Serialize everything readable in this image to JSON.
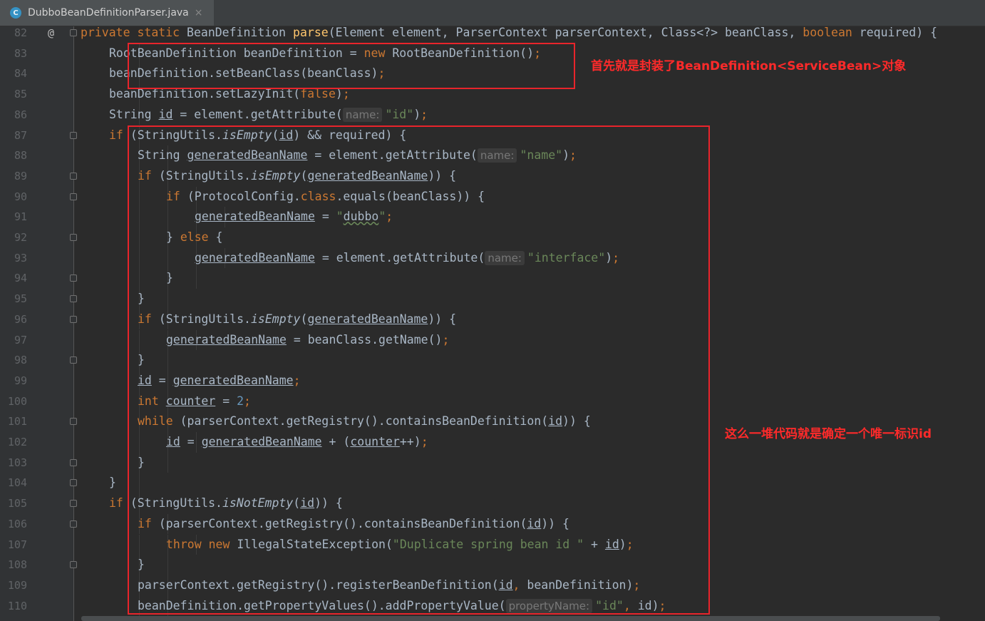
{
  "tab": {
    "icon": "C",
    "title": "DubboBeanDefinitionParser.java",
    "close": "×"
  },
  "gutter_marker": "@",
  "annotations": {
    "note1": "首先就是封装了BeanDefinition<ServiceBean>对象",
    "note2": "这么一堆代码就是确定一个唯一标识id"
  },
  "colors": {
    "keyword": "#cc7832",
    "method_decl": "#ffc66d",
    "string": "#6a8759",
    "number": "#6897bb",
    "default": "#a9b7c6",
    "annotation_red": "#e8242b"
  },
  "lines": [
    {
      "n": "82",
      "i": 1,
      "mark": "@",
      "fold": true,
      "t": [
        [
          "kw",
          "private static "
        ],
        [
          "",
          "BeanDefinition "
        ],
        [
          "fn",
          "parse"
        ],
        [
          "",
          "(Element element, ParserContext parserContext, Class<?> beanClass, "
        ],
        [
          "kw",
          "boolean "
        ],
        [
          "",
          "required) {"
        ]
      ]
    },
    {
      "n": "83",
      "i": 2,
      "t": [
        [
          "",
          "RootBeanDefinition beanDefinition = "
        ],
        [
          "kw",
          "new "
        ],
        [
          "",
          "RootBeanDefinition()"
        ],
        [
          "kw",
          ";"
        ]
      ]
    },
    {
      "n": "84",
      "i": 2,
      "t": [
        [
          "",
          "beanDefinition.setBeanClass(beanClass)"
        ],
        [
          "kw",
          ";"
        ]
      ]
    },
    {
      "n": "85",
      "i": 2,
      "t": [
        [
          "",
          "beanDefinition.setLazyInit("
        ],
        [
          "kw",
          "false"
        ],
        [
          "",
          ")"
        ],
        [
          "kw",
          ";"
        ]
      ]
    },
    {
      "n": "86",
      "i": 2,
      "t": [
        [
          "",
          "String "
        ],
        [
          "ul",
          "id"
        ],
        [
          "",
          " = element.getAttribute("
        ],
        [
          "hint",
          "name:"
        ],
        [
          "str",
          "\"id\""
        ],
        [
          "",
          ")"
        ],
        [
          "kw",
          ";"
        ]
      ]
    },
    {
      "n": "87",
      "i": 2,
      "fold": true,
      "t": [
        [
          "kw",
          "if "
        ],
        [
          "",
          "(StringUtils."
        ],
        [
          "it",
          "isEmpty"
        ],
        [
          "",
          "("
        ],
        [
          "ul",
          "id"
        ],
        [
          "",
          ") && required) {"
        ]
      ]
    },
    {
      "n": "88",
      "i": 3,
      "t": [
        [
          "",
          "String "
        ],
        [
          "ul",
          "generatedBeanName"
        ],
        [
          "",
          " = element.getAttribute("
        ],
        [
          "hint",
          "name:"
        ],
        [
          "str",
          "\"name\""
        ],
        [
          "",
          ")"
        ],
        [
          "kw",
          ";"
        ]
      ]
    },
    {
      "n": "89",
      "i": 3,
      "fold": true,
      "t": [
        [
          "kw",
          "if "
        ],
        [
          "",
          "(StringUtils."
        ],
        [
          "it",
          "isEmpty"
        ],
        [
          "",
          "("
        ],
        [
          "ul",
          "generatedBeanName"
        ],
        [
          "",
          ")) {"
        ]
      ]
    },
    {
      "n": "90",
      "i": 4,
      "fold": true,
      "t": [
        [
          "kw",
          "if "
        ],
        [
          "",
          "(ProtocolConfig."
        ],
        [
          "kw",
          "class"
        ],
        [
          "",
          ".equals(beanClass)) {"
        ]
      ]
    },
    {
      "n": "91",
      "i": 5,
      "t": [
        [
          "ul",
          "generatedBeanName"
        ],
        [
          "",
          " = "
        ],
        [
          "str",
          "\""
        ],
        [
          "squig",
          "dubbo"
        ],
        [
          "str",
          "\""
        ],
        [
          "kw",
          ";"
        ]
      ]
    },
    {
      "n": "92",
      "i": 4,
      "fold": true,
      "t": [
        [
          "",
          "} "
        ],
        [
          "kw",
          "else "
        ],
        [
          "",
          "{"
        ]
      ]
    },
    {
      "n": "93",
      "i": 5,
      "t": [
        [
          "ul",
          "generatedBeanName"
        ],
        [
          "",
          " = element.getAttribute("
        ],
        [
          "hint",
          "name:"
        ],
        [
          "str",
          "\"interface\""
        ],
        [
          "",
          ")"
        ],
        [
          "kw",
          ";"
        ]
      ]
    },
    {
      "n": "94",
      "i": 4,
      "fold": true,
      "t": [
        [
          "",
          "}"
        ]
      ]
    },
    {
      "n": "95",
      "i": 3,
      "fold": true,
      "t": [
        [
          "",
          "}"
        ]
      ]
    },
    {
      "n": "96",
      "i": 3,
      "fold": true,
      "t": [
        [
          "kw",
          "if "
        ],
        [
          "",
          "(StringUtils."
        ],
        [
          "it",
          "isEmpty"
        ],
        [
          "",
          "("
        ],
        [
          "ul",
          "generatedBeanName"
        ],
        [
          "",
          ")) {"
        ]
      ]
    },
    {
      "n": "97",
      "i": 4,
      "t": [
        [
          "ul",
          "generatedBeanName"
        ],
        [
          "",
          " = beanClass.getName()"
        ],
        [
          "kw",
          ";"
        ]
      ]
    },
    {
      "n": "98",
      "i": 3,
      "fold": true,
      "t": [
        [
          "",
          "}"
        ]
      ]
    },
    {
      "n": "99",
      "i": 3,
      "t": [
        [
          "ul",
          "id"
        ],
        [
          "",
          " = "
        ],
        [
          "ul",
          "generatedBeanName"
        ],
        [
          "kw",
          ";"
        ]
      ]
    },
    {
      "n": "100",
      "i": 3,
      "t": [
        [
          "kw",
          "int "
        ],
        [
          "ul",
          "counter"
        ],
        [
          "",
          " = "
        ],
        [
          "num",
          "2"
        ],
        [
          "kw",
          ";"
        ]
      ]
    },
    {
      "n": "101",
      "i": 3,
      "fold": true,
      "t": [
        [
          "kw",
          "while "
        ],
        [
          "",
          "(parserContext.getRegistry().containsBeanDefinition("
        ],
        [
          "ul",
          "id"
        ],
        [
          "",
          ")) {"
        ]
      ]
    },
    {
      "n": "102",
      "i": 4,
      "t": [
        [
          "ul",
          "id"
        ],
        [
          "",
          " = "
        ],
        [
          "ul",
          "generatedBeanName"
        ],
        [
          "",
          " + ("
        ],
        [
          "ul",
          "counter"
        ],
        [
          "",
          "++)"
        ],
        [
          "kw",
          ";"
        ]
      ]
    },
    {
      "n": "103",
      "i": 3,
      "fold": true,
      "t": [
        [
          "",
          "}"
        ]
      ]
    },
    {
      "n": "104",
      "i": 2,
      "fold": true,
      "t": [
        [
          "",
          "}"
        ]
      ]
    },
    {
      "n": "105",
      "i": 2,
      "fold": true,
      "t": [
        [
          "kw",
          "if "
        ],
        [
          "",
          "(StringUtils."
        ],
        [
          "it",
          "isNotEmpty"
        ],
        [
          "",
          "("
        ],
        [
          "ul",
          "id"
        ],
        [
          "",
          ")) {"
        ]
      ]
    },
    {
      "n": "106",
      "i": 3,
      "fold": true,
      "t": [
        [
          "kw",
          "if "
        ],
        [
          "",
          "(parserContext.getRegistry().containsBeanDefinition("
        ],
        [
          "ul",
          "id"
        ],
        [
          "",
          ")) {"
        ]
      ]
    },
    {
      "n": "107",
      "i": 4,
      "t": [
        [
          "kw",
          "throw new "
        ],
        [
          "",
          "IllegalStateException("
        ],
        [
          "str",
          "\"Duplicate spring bean id \""
        ],
        [
          "",
          " + "
        ],
        [
          "ul",
          "id"
        ],
        [
          "",
          ")"
        ],
        [
          "kw",
          ";"
        ]
      ]
    },
    {
      "n": "108",
      "i": 3,
      "fold": true,
      "t": [
        [
          "",
          "}"
        ]
      ]
    },
    {
      "n": "109",
      "i": 3,
      "t": [
        [
          "",
          "parserContext.getRegistry().registerBeanDefinition("
        ],
        [
          "ul",
          "id"
        ],
        [
          "kw",
          ", "
        ],
        [
          "",
          "beanDefinition)"
        ],
        [
          "kw",
          ";"
        ]
      ]
    },
    {
      "n": "110",
      "i": 3,
      "t": [
        [
          "",
          "beanDefinition.getPropertyValues().addPropertyValue("
        ],
        [
          "hint",
          "propertyName:"
        ],
        [
          "str",
          "\"id\""
        ],
        [
          "kw",
          ", "
        ],
        [
          "",
          "id)"
        ],
        [
          "kw",
          ";"
        ]
      ]
    }
  ]
}
